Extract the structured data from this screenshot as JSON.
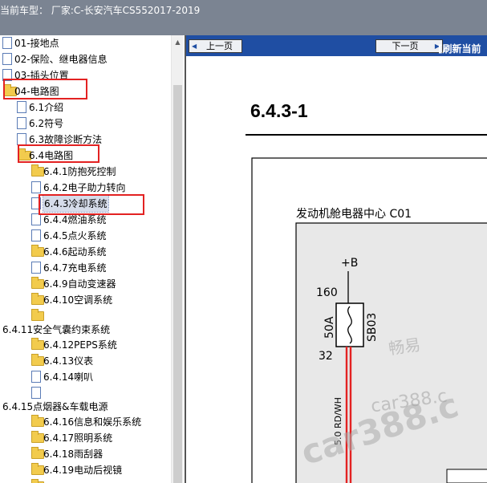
{
  "window": {
    "title_prefix": "当前车型：",
    "title_value": "厂家:C-长安汽车CS552017-2019"
  },
  "tree": {
    "items": [
      {
        "label": "01-接地点",
        "type": "doc"
      },
      {
        "label": "02-保险、继电器信息",
        "type": "doc"
      },
      {
        "label": "03-插头位置",
        "type": "doc",
        "expand": "+"
      },
      {
        "label": "04-电路图",
        "type": "folder",
        "expand": "−"
      },
      {
        "label": "6.1介绍",
        "type": "doc"
      },
      {
        "label": "6.2符号",
        "type": "doc"
      },
      {
        "label": "6.3故障诊断方法",
        "type": "doc"
      },
      {
        "label": "6.4电路图",
        "type": "folder",
        "expand": "−"
      },
      {
        "label": "6.4.1防抱死控制",
        "type": "folder",
        "expand": "+"
      },
      {
        "label": "6.4.2电子助力转向",
        "type": "doc"
      },
      {
        "label": "6.4.3冷却系统",
        "type": "doc",
        "selected": true
      },
      {
        "label": "6.4.4燃油系统",
        "type": "doc"
      },
      {
        "label": "6.4.5点火系统",
        "type": "doc"
      },
      {
        "label": "6.4.6起动系统",
        "type": "folder",
        "expand": "+"
      },
      {
        "label": "6.4.7充电系统",
        "type": "doc"
      },
      {
        "label": "6.4.9自动变速器",
        "type": "folder",
        "expand": "+"
      },
      {
        "label": "6.4.10空调系统",
        "type": "folder",
        "expand": "+"
      },
      {
        "label": "",
        "type": "folder",
        "expand": "+"
      },
      {
        "label": "6.4.11安全气囊约束系统",
        "type": "text"
      },
      {
        "label": "6.4.12PEPS系统",
        "type": "folder",
        "expand": "+"
      },
      {
        "label": "6.4.13仪表",
        "type": "folder",
        "expand": "+"
      },
      {
        "label": "6.4.14喇叭",
        "type": "doc"
      },
      {
        "label": "",
        "type": "doc"
      },
      {
        "label": "6.4.15点烟器&车载电源",
        "type": "text"
      },
      {
        "label": "6.4.16信息和娱乐系统",
        "type": "folder",
        "expand": "+"
      },
      {
        "label": "6.4.17照明系统",
        "type": "folder",
        "expand": "+"
      },
      {
        "label": "6.4.18雨刮器",
        "type": "folder",
        "expand": "+"
      },
      {
        "label": "6.4.19电动后视镜",
        "type": "folder",
        "expand": "+"
      },
      {
        "label": "",
        "type": "folder",
        "expand": "+"
      }
    ]
  },
  "nav": {
    "prev_label": "上一页",
    "next_label": "下一页",
    "refresh_label": "[刷新当前"
  },
  "diagram": {
    "page_title": "6.4.3-1",
    "box_title": "发动机舱电器中心 C01",
    "supply": "+B",
    "pin_top": "160",
    "pin_bottom": "32",
    "fuse_rating": "50A",
    "fuse_id": "SB03",
    "wire_label": "5.0 RD/WH"
  },
  "watermark": {
    "line1": "畅易",
    "line2": "car388.c",
    "line3": "car388.c"
  },
  "colors": {
    "titlebar": "#7b8492",
    "navbar": "#1f4ea3",
    "wire": "#e32222",
    "highlight_box": "#e32222",
    "folder": "#f2cb4d"
  }
}
